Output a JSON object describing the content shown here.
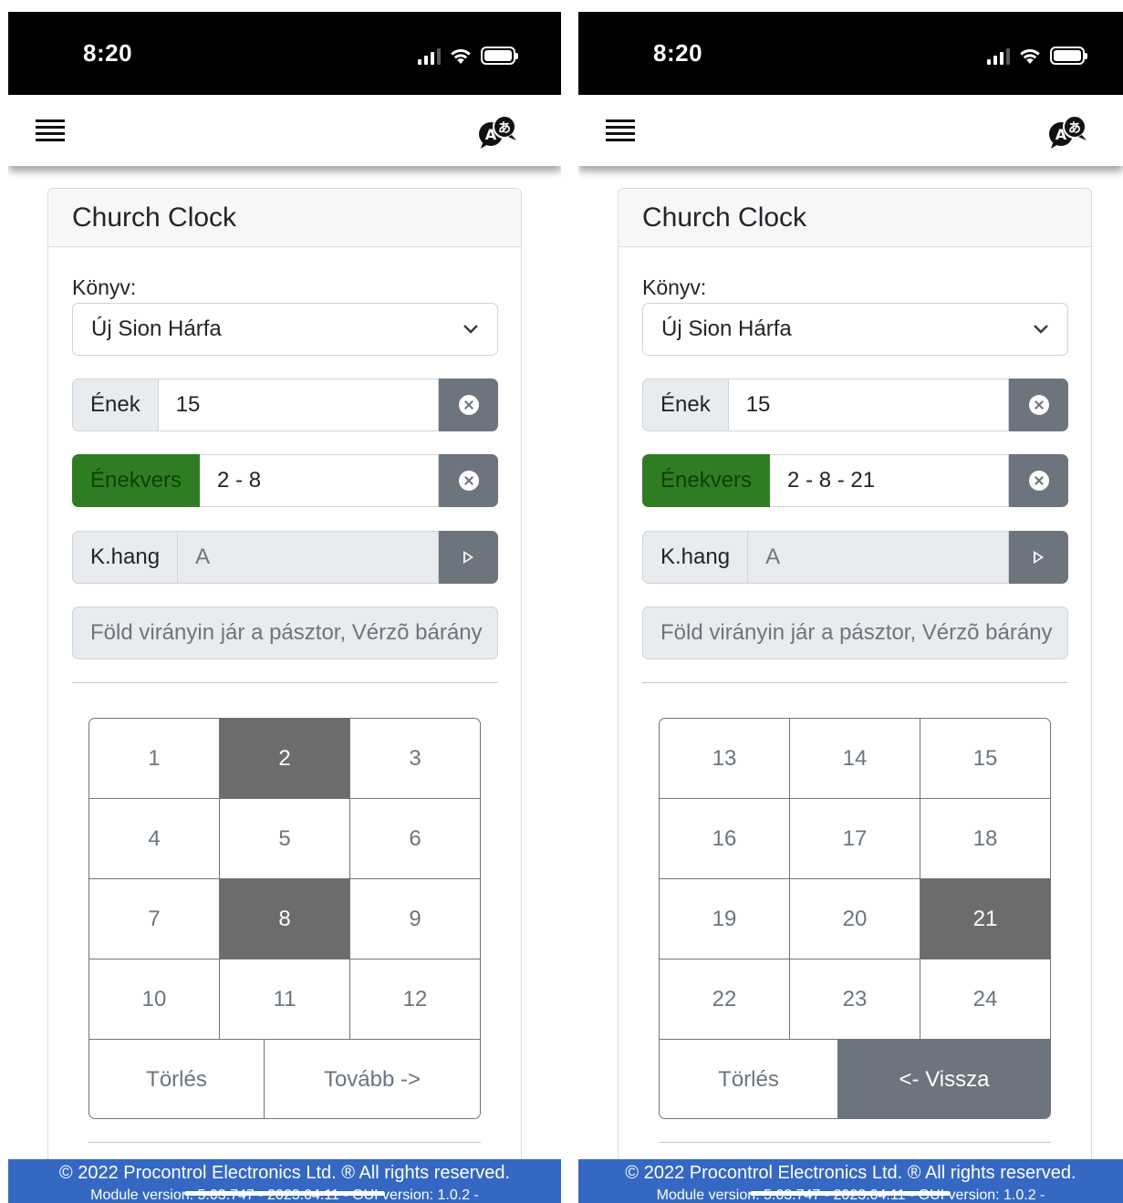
{
  "status": {
    "time": "8:20"
  },
  "app": {
    "card_title": "Church Clock",
    "book_label": "Könyv:",
    "book_value": "Új Sion Hárfa",
    "enek_label": "Ének",
    "enek_value": "15",
    "enekvers_label": "Énekvers",
    "khang_label": "K.hang",
    "khang_value": "A",
    "hymn_title": "Föld virányin jár a pásztor, Vérzõ bárány"
  },
  "left_screen": {
    "enekvers_value": "2 - 8",
    "grid": [
      [
        {
          "n": "1",
          "active": false
        },
        {
          "n": "2",
          "active": true
        },
        {
          "n": "3",
          "active": false
        }
      ],
      [
        {
          "n": "4",
          "active": false
        },
        {
          "n": "5",
          "active": false
        },
        {
          "n": "6",
          "active": false
        }
      ],
      [
        {
          "n": "7",
          "active": false
        },
        {
          "n": "8",
          "active": true
        },
        {
          "n": "9",
          "active": false
        }
      ],
      [
        {
          "n": "10",
          "active": false
        },
        {
          "n": "11",
          "active": false
        },
        {
          "n": "12",
          "active": false
        }
      ]
    ],
    "delete_label": "Törlés",
    "next_label": "Tovább ->"
  },
  "right_screen": {
    "enekvers_value": "2 - 8 - 21",
    "grid": [
      [
        {
          "n": "13",
          "active": false
        },
        {
          "n": "14",
          "active": false
        },
        {
          "n": "15",
          "active": false
        }
      ],
      [
        {
          "n": "16",
          "active": false
        },
        {
          "n": "17",
          "active": false
        },
        {
          "n": "18",
          "active": false
        }
      ],
      [
        {
          "n": "19",
          "active": false
        },
        {
          "n": "20",
          "active": false
        },
        {
          "n": "21",
          "active": true
        }
      ],
      [
        {
          "n": "22",
          "active": false
        },
        {
          "n": "23",
          "active": false
        },
        {
          "n": "24",
          "active": false
        }
      ]
    ],
    "delete_label": "Törlés",
    "back_label": "<- Vissza"
  },
  "footer": {
    "copyright": "© 2022 Procontrol Electronics Ltd. ® All rights reserved.",
    "version_line": "Module version: 5.03.747 - 2023.04.11 - GUI version: 1.0.2 -"
  },
  "icons": {
    "menu": "hamburger-menu-icon",
    "language": "translate-language-icon",
    "clear": "clear-circle-x-icon",
    "play": "play-triangle-icon",
    "dropdown": "chevron-down-icon"
  },
  "colors": {
    "active_cell": "#6c6c6c",
    "green_addon": "#2f7d22",
    "secondary_button": "#6c757d",
    "footer": "#3468c2"
  }
}
